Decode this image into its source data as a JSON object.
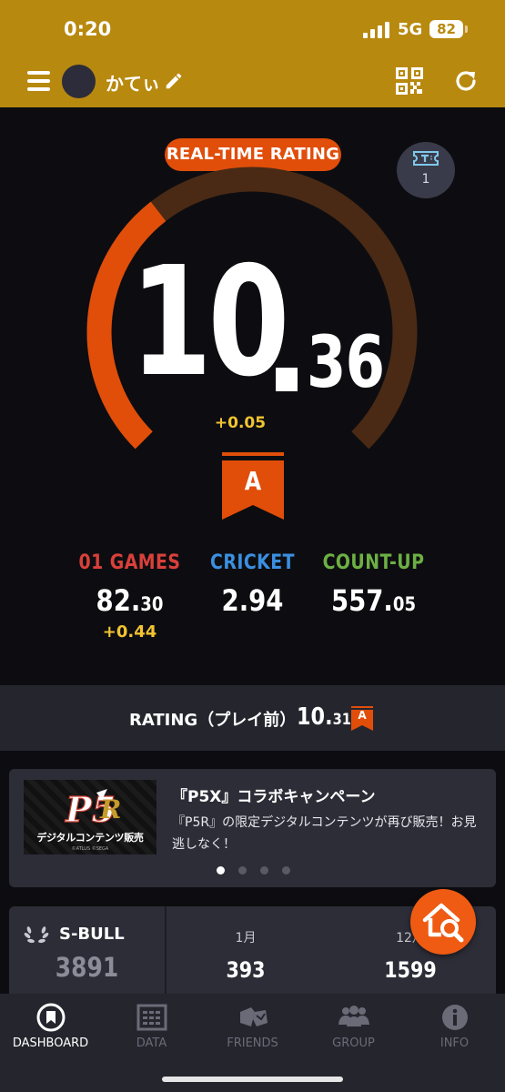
{
  "status": {
    "time": "0:20",
    "network": "5G",
    "battery": "82"
  },
  "header": {
    "user_name": "かてぃ"
  },
  "rating": {
    "badge": "REAL-TIME RATING",
    "ticket_count": "1",
    "integer": "10",
    "decimal": "36",
    "delta": "+0.05",
    "class": "A",
    "gauge_fraction": 0.36,
    "colors": {
      "accent": "#e04e0a",
      "track": "#4a2a14",
      "delta": "#f2c431"
    }
  },
  "stats": [
    {
      "title": "01 GAMES",
      "int": "82.",
      "dec": "30",
      "delta": "+0.44",
      "color": "#d9403a"
    },
    {
      "title": "CRICKET",
      "int": "2.94",
      "dec": "",
      "delta": "",
      "color": "#3b8fe0"
    },
    {
      "title": "COUNT-UP",
      "int": "557.",
      "dec": "05",
      "delta": "",
      "color": "#6cb043"
    }
  ],
  "pre_rating": {
    "label": "RATING（プレイ前）",
    "int": "10.",
    "dec": "31",
    "class": "A"
  },
  "campaign": {
    "title": "『P5X』コラボキャンペーン",
    "description": "『P5R』の限定デジタルコンテンツが再び販売！お見逃しなく！",
    "image_caption": "デジタルコンテンツ販売",
    "image_copyright": "©ATLUS ©SEGA",
    "slide_count": 4,
    "active_slide": 0
  },
  "sbull": {
    "label": "S-BULL",
    "total": "3891",
    "months": [
      {
        "label": "1月",
        "value": "393"
      },
      {
        "label": "12月",
        "value": "1599"
      }
    ]
  },
  "nav": {
    "items": [
      {
        "label": "DASHBOARD",
        "icon": "dashboard-icon",
        "active": true
      },
      {
        "label": "DATA",
        "icon": "data-icon",
        "active": false
      },
      {
        "label": "FRIENDS",
        "icon": "friends-icon",
        "active": false
      },
      {
        "label": "GROUP",
        "icon": "group-icon",
        "active": false
      },
      {
        "label": "INFO",
        "icon": "info-icon",
        "active": false
      }
    ]
  }
}
